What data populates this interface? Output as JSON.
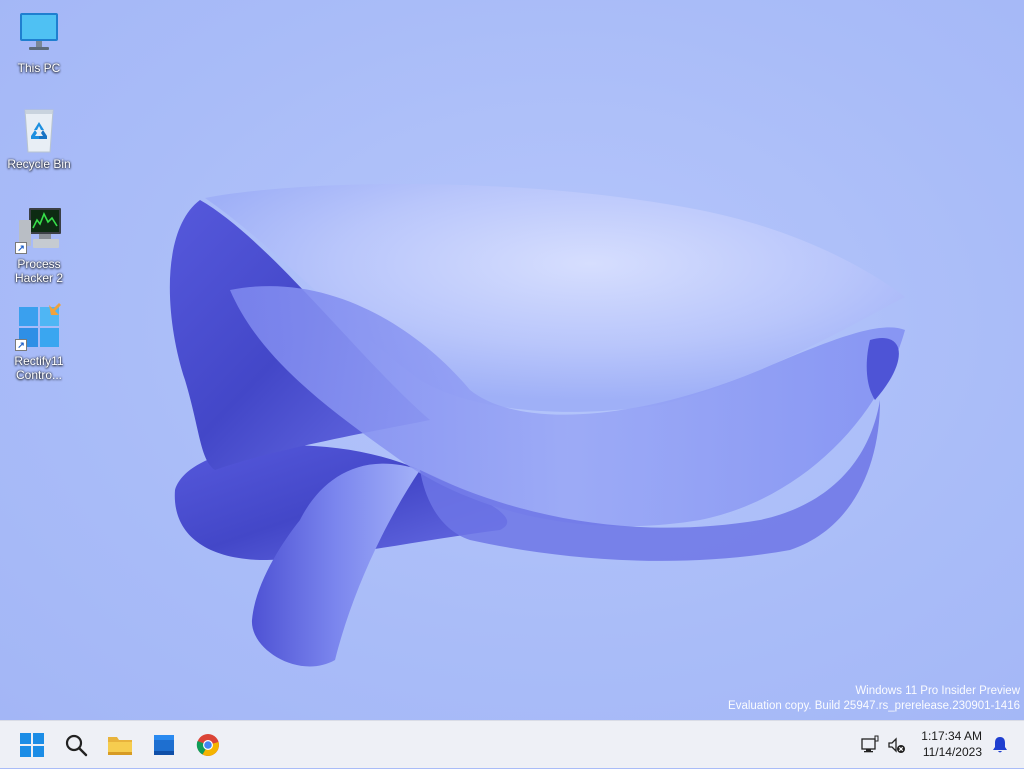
{
  "desktop": {
    "icons": [
      {
        "label": "This PC",
        "glyph": "monitor-icon"
      },
      {
        "label": "Recycle Bin",
        "glyph": "recycle-bin-icon"
      },
      {
        "label": "Process Hacker 2",
        "glyph": "process-hacker-icon",
        "shortcut": true
      },
      {
        "label": "Rectify11 Contro...",
        "glyph": "rectify11-control-icon",
        "shortcut": true
      }
    ]
  },
  "watermark": {
    "line1": "Windows 11 Pro Insider Preview",
    "line2": "Evaluation copy. Build 25947.rs_prerelease.230901-1416"
  },
  "taskbar": {
    "items": [
      "start-icon",
      "search-icon",
      "file-explorer-icon",
      "microsoft-store-icon",
      "chrome-icon"
    ],
    "tray": {
      "time": "1:17:34 AM",
      "date": "11/14/2023",
      "icons": [
        "network-icon",
        "volume-muted-icon",
        "notification-bell-icon"
      ]
    }
  },
  "colors": {
    "wallpaper_bg": "#a9bcf8",
    "bloom_dark": "#4b4fd0",
    "bloom_light": "#c9d3fd",
    "taskbar_bg": "#eef0f6"
  }
}
